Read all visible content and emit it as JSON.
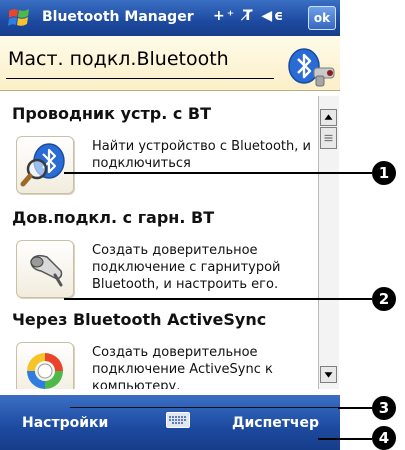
{
  "titlebar": {
    "app_title": "Bluetooth Manager",
    "status_icons": "+⁺ T̸ ◀ϵ",
    "ok_label": "ok"
  },
  "header": {
    "title": "Маст. подкл.Bluetooth"
  },
  "items": [
    {
      "title": "Проводник устр. с BT",
      "description": "Найти устройство с Bluetooth, и подключиться",
      "icon": "bluetooth-search-icon"
    },
    {
      "title": "Дов.подкл. с гарн. BT",
      "description": "Создать доверительное подключение с гарнитурой Bluetooth, и настроить его.",
      "icon": "headset-icon"
    },
    {
      "title": "Через Bluetooth ActiveSync",
      "description": "Создать доверительное подключение ActiveSync к компьютеру.",
      "icon": "activesync-icon"
    }
  ],
  "bottombar": {
    "left_softkey": "Настройки",
    "right_softkey": "Диспетчер",
    "input_icon": "keyboard-icon"
  },
  "callouts": [
    "1",
    "2",
    "3",
    "4"
  ],
  "colors": {
    "bar_blue": "#1d4aa0",
    "header_bg": "#fbefc8",
    "bluetooth_blue": "#2a6cd6"
  }
}
